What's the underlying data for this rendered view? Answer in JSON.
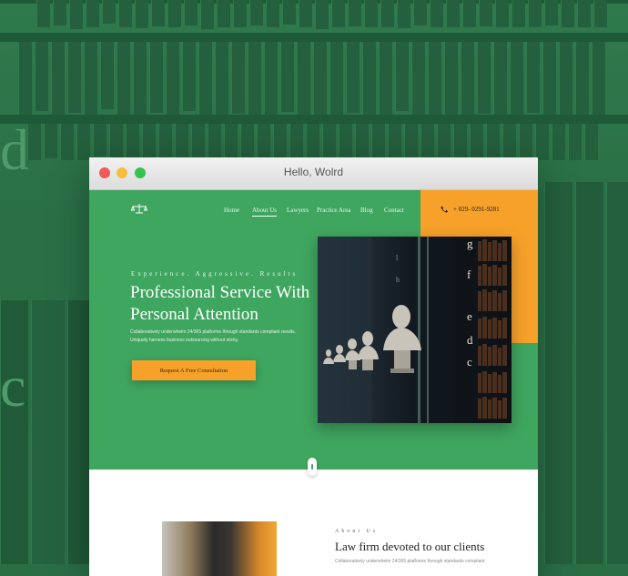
{
  "window": {
    "title": "Hello, Wolrd"
  },
  "site": {
    "logo_icon": "scales-icon",
    "nav": [
      "Home",
      "About Us",
      "Lawyers",
      "Practice Area",
      "Blog",
      "Contact"
    ],
    "active_nav": "About Us",
    "phone": "+ 029- 0291-9281"
  },
  "hero": {
    "kicker": "Experience. Aggressive. Results",
    "headline": "Professional Service With Personal Attention",
    "description": "Collaboratively underwhelm 24/365 platforms through standards compliant results. Uniquely harness business outsourcing without sticky.",
    "cta_label": "Request A Free Consultation",
    "photo_letters": [
      "g",
      "f",
      "e",
      "d",
      "c",
      "l",
      "h"
    ]
  },
  "about": {
    "kicker": "About Us",
    "title": "Law firm devoted to our clients",
    "text": "Collaboratively underwhelm 24/365 platforms through standards compliant"
  },
  "colors": {
    "green": "#3fa65f",
    "orange": "#f7a12a",
    "background": "#2a6e46"
  },
  "background": {
    "letters": [
      "d",
      "c"
    ]
  }
}
